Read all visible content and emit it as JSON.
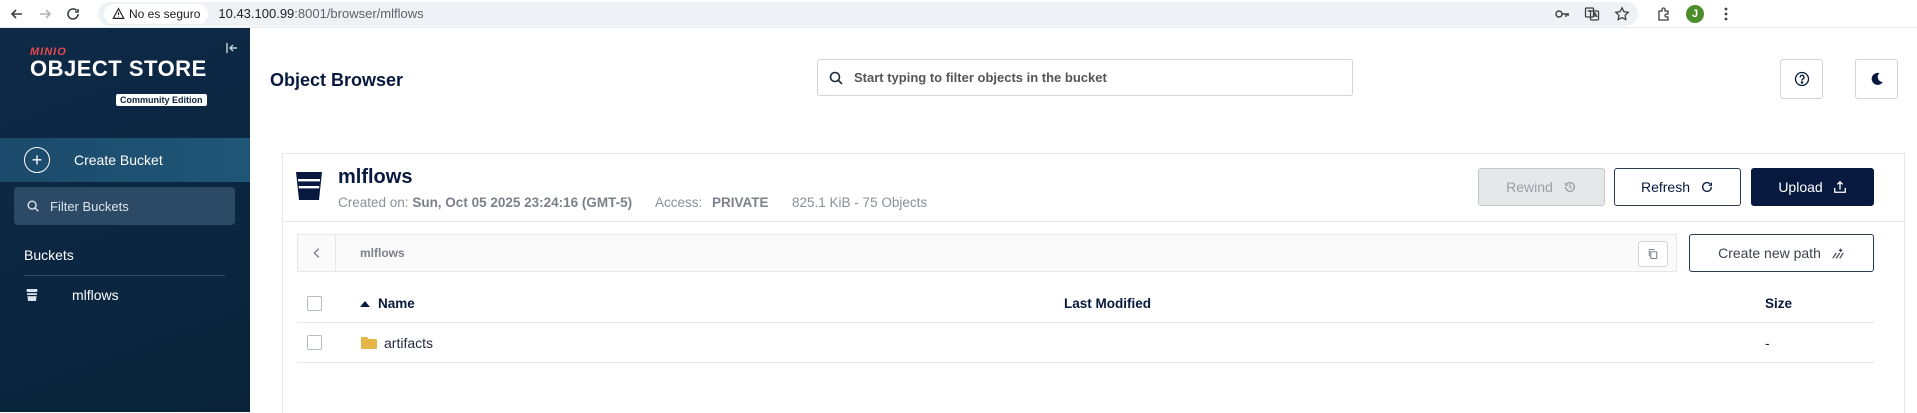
{
  "browser": {
    "security_label": "No es seguro",
    "url_host": "10.43.100.99",
    "url_rest": ":8001/browser/mlflows",
    "profile_initial": "J"
  },
  "sidebar": {
    "logo_brand": "MINIO",
    "logo_title": "OBJECT STORE",
    "logo_edition": "Community Edition",
    "create_bucket_label": "Create Bucket",
    "filter_buckets_label": "Filter Buckets",
    "buckets_heading": "Buckets",
    "buckets": [
      {
        "name": "mlflows"
      }
    ]
  },
  "header": {
    "title": "Object Browser",
    "search_placeholder": "Start typing to filter objects in the bucket"
  },
  "bucket": {
    "name": "mlflows",
    "created_label": "Created on:",
    "created_value": "Sun, Oct 05 2025 23:24:16 (GMT-5)",
    "access_label": "Access:",
    "access_value": "PRIVATE",
    "usage": "825.1 KiB - 75 Objects",
    "rewind_label": "Rewind",
    "refresh_label": "Refresh",
    "upload_label": "Upload",
    "breadcrumb_path": "mlflows",
    "create_path_label": "Create new path"
  },
  "table": {
    "columns": {
      "name": "Name",
      "modified": "Last Modified",
      "size": "Size"
    },
    "rows": [
      {
        "name": "artifacts",
        "modified": "",
        "size": "-"
      }
    ]
  },
  "colors": {
    "sidebar_bg": "#0b2640",
    "primary": "#07193e",
    "accent_red": "#e7484d",
    "folder": "#e6b54a"
  }
}
